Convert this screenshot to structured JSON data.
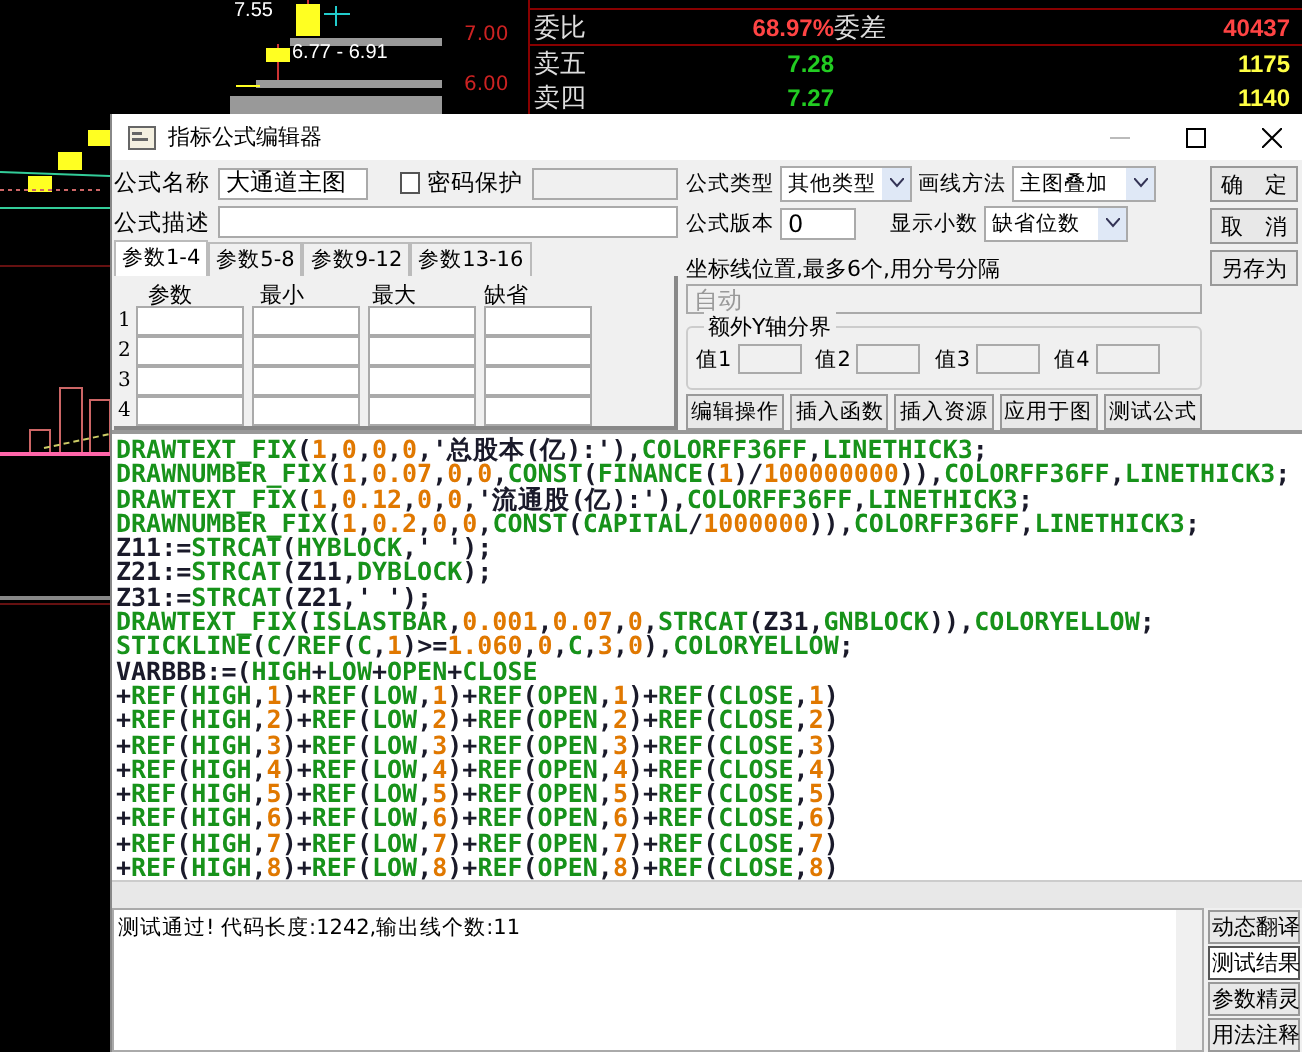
{
  "chart_top": {
    "price_labels": [
      "7.00",
      "6.00"
    ],
    "candle_labels": [
      "7.55",
      "6.77 - 6.91"
    ]
  },
  "quote_panel": {
    "rows": [
      {
        "label": "委比",
        "value": {
          "text": "68.97%",
          "color": "#ff4444"
        },
        "label_2": "委差",
        "volume": {
          "text": "40437",
          "color": "#ff4444"
        }
      },
      {
        "label": "卖五",
        "value": {
          "text": "7.28",
          "color": "#22cc22"
        },
        "volume": {
          "text": "1175",
          "color": "#ffff44"
        }
      },
      {
        "label": "卖四",
        "value": {
          "text": "7.27",
          "color": "#22cc22"
        },
        "volume": {
          "text": "1140",
          "color": "#ffff44"
        }
      }
    ]
  },
  "window": {
    "title": "指标公式编辑器"
  },
  "form": {
    "name_label": "公式名称",
    "name_value": "大通道主图",
    "password": {
      "label": "密码保护",
      "checked": false
    },
    "desc_label": "公式描述",
    "type_label": "公式类型",
    "type_value": "其他类型",
    "draw_label": "画线方法",
    "draw_value": "主图叠加",
    "version_label": "公式版本",
    "version_value": "0",
    "decimals_label": "显示小数",
    "decimals_value": "缺省位数"
  },
  "buttons_right": [
    "确　定",
    "取　消",
    "另存为"
  ],
  "param_tabs": [
    {
      "label": "参数1-4",
      "selected": true
    },
    {
      "label": "参数5-8",
      "selected": false
    },
    {
      "label": "参数9-12",
      "selected": false
    },
    {
      "label": "参数13-16",
      "selected": false
    }
  ],
  "param_table": {
    "columns": [
      "参数",
      "最小",
      "最大",
      "缺省"
    ],
    "rows": [
      "1",
      "2",
      "3",
      "4"
    ]
  },
  "axis_lines": {
    "label": "坐标线位置,最多6个,用分号分隔",
    "placeholder": "自动"
  },
  "extra_y": {
    "title": "额外Y轴分界",
    "fields": [
      "值1",
      "值2",
      "值3",
      "值4"
    ]
  },
  "action_buttons": [
    "编辑操作",
    "插入函数",
    "插入资源",
    "应用于图",
    "测试公式"
  ],
  "code_lines": [
    "DRAWTEXT_FIX(1,0,0,0,'总股本(亿):'),COLORFF36FF,LINETHICK3;",
    "DRAWNUMBER_FIX(1,0.07,0,0,CONST(FINANCE(1)/100000000)),COLORFF36FF,LINETHICK3;",
    "DRAWTEXT_FIX(1,0.12,0,0,'流通股(亿):'),COLORFF36FF,LINETHICK3;",
    "DRAWNUMBER_FIX(1,0.2,0,0,CONST(CAPITAL/1000000)),COLORFF36FF,LINETHICK3;",
    "Z11:=STRCAT(HYBLOCK,' ');",
    "Z21:=STRCAT(Z11,DYBLOCK);",
    "Z31:=STRCAT(Z21,' ');",
    "DRAWTEXT_FIX(ISLASTBAR,0.001,0.07,0,STRCAT(Z31,GNBLOCK)),COLORYELLOW;",
    "STICKLINE(C/REF(C,1)>=1.060,0,C,3,0),COLORYELLOW;",
    "VARBBB:=(HIGH+LOW+OPEN+CLOSE",
    "+REF(HIGH,1)+REF(LOW,1)+REF(OPEN,1)+REF(CLOSE,1)",
    "+REF(HIGH,2)+REF(LOW,2)+REF(OPEN,2)+REF(CLOSE,2)",
    "+REF(HIGH,3)+REF(LOW,3)+REF(OPEN,3)+REF(CLOSE,3)",
    "+REF(HIGH,4)+REF(LOW,4)+REF(OPEN,4)+REF(CLOSE,4)",
    "+REF(HIGH,5)+REF(LOW,5)+REF(OPEN,5)+REF(CLOSE,5)",
    "+REF(HIGH,6)+REF(LOW,6)+REF(OPEN,6)+REF(CLOSE,6)",
    "+REF(HIGH,7)+REF(LOW,7)+REF(OPEN,7)+REF(CLOSE,7)",
    "+REF(HIGH,8)+REF(LOW,8)+REF(OPEN,8)+REF(CLOSE,8)"
  ],
  "message": "测试通过! 代码长度:1242,输出线个数:11",
  "side_buttons": [
    {
      "label": "动态翻译",
      "selected": false
    },
    {
      "label": "测试结果",
      "selected": true
    },
    {
      "label": "参数精灵",
      "selected": false
    },
    {
      "label": "用法注释",
      "selected": false
    }
  ]
}
